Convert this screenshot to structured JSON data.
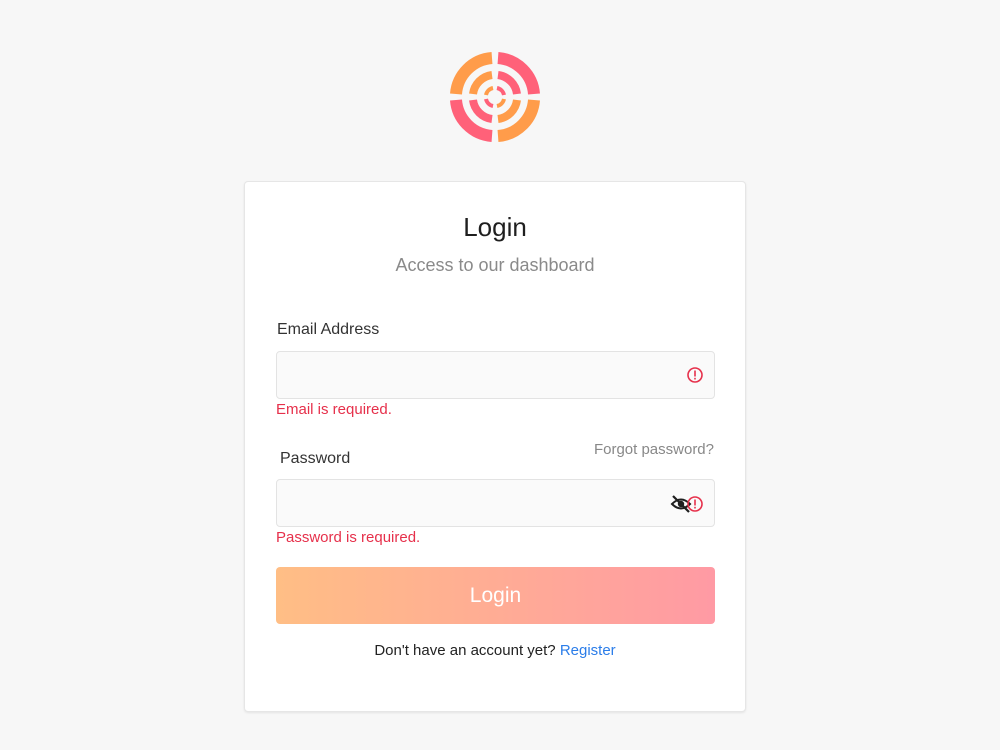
{
  "login_form": {
    "title": "Login",
    "subtitle": "Access to our dashboard",
    "email": {
      "label": "Email Address",
      "value": "",
      "placeholder": "",
      "error": "Email is required."
    },
    "password": {
      "label": "Password",
      "value": "",
      "placeholder": "",
      "error": "Password is required.",
      "forgot_link": "Forgot password?"
    },
    "submit_label": "Login",
    "register_prompt": "Don't have an account yet?",
    "register_link": "Register"
  },
  "colors": {
    "error": "#e6304b",
    "link": "#2b7de9",
    "button_gradient_start": "#ffbe85",
    "button_gradient_end": "#ff9aa4",
    "logo_orange": "#ff9c4a",
    "logo_pink": "#ff6179"
  },
  "icons": {
    "logo": "target-logo-icon",
    "email_error": "error-circle-icon",
    "password_toggle": "eye-off-icon",
    "password_error": "error-circle-icon"
  }
}
